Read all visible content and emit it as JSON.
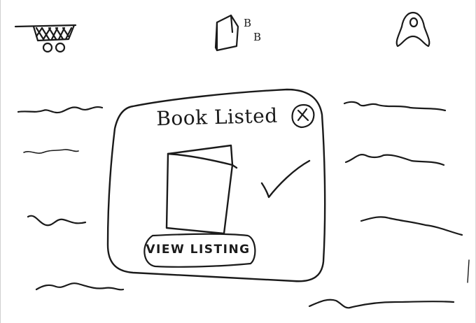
{
  "header": {
    "cart_icon": "shopping-basket-icon",
    "logo_icon": "book-logo-icon",
    "logo_letters": [
      "B",
      "B"
    ],
    "profile_icon": "user-avatar-icon"
  },
  "modal": {
    "title": "Book Listed",
    "close_icon": "close-icon",
    "book_icon": "book-image-icon",
    "view_button_label": "VIEW LISTING"
  },
  "status_icon": "checkmark-icon",
  "colors": {
    "ink": "#1a1a1a",
    "paper": "#ffffff"
  }
}
